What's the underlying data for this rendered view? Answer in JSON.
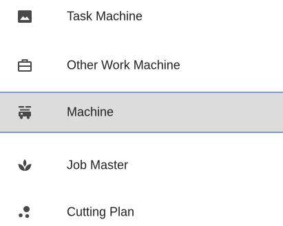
{
  "menu": {
    "items": [
      {
        "label": "Task Machine",
        "icon": "image-icon",
        "selected": false
      },
      {
        "label": "Other Work Machine",
        "icon": "toolbox-icon",
        "selected": false
      },
      {
        "label": "Machine",
        "icon": "machine-icon",
        "selected": true
      },
      {
        "label": "Job Master",
        "icon": "spa-leaf-icon",
        "selected": false
      },
      {
        "label": "Cutting Plan",
        "icon": "scatter-dots-icon",
        "selected": false
      }
    ]
  },
  "colors": {
    "icon": "#484848",
    "text": "#222222",
    "selected_background": "#dcdcdc",
    "selected_border": "#7f98c8"
  }
}
